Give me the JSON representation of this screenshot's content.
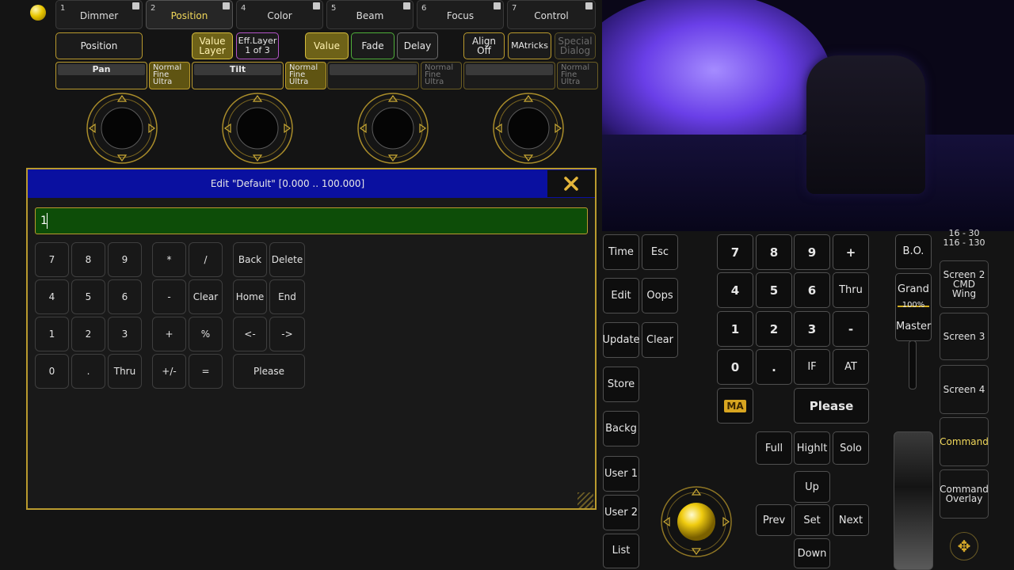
{
  "presetTabs": [
    {
      "num": "1",
      "label": "Dimmer"
    },
    {
      "num": "2",
      "label": "Position"
    },
    {
      "num": "4",
      "label": "Color"
    },
    {
      "num": "5",
      "label": "Beam"
    },
    {
      "num": "6",
      "label": "Focus"
    },
    {
      "num": "7",
      "label": "Control"
    }
  ],
  "toolbar": {
    "position": "Position",
    "valueLayer": [
      "Value",
      "Layer"
    ],
    "effLayer": [
      "Eff.Layer",
      "1 of 3"
    ],
    "value": "Value",
    "fade": "Fade",
    "delay": "Delay",
    "alignOff": [
      "Align",
      "Off"
    ],
    "matricks": "MAtricks",
    "specialDialog": [
      "Special",
      "Dialog"
    ]
  },
  "encoders": [
    {
      "label": "Pan",
      "res": [
        "Normal",
        "Fine",
        "Ultra"
      ]
    },
    {
      "label": "Tilt",
      "res": [
        "Normal",
        "Fine",
        "Ultra"
      ]
    },
    {
      "label": "",
      "res": [
        "Normal",
        "Fine",
        "Ultra"
      ]
    },
    {
      "label": "",
      "res": [
        "Normal",
        "Fine",
        "Ultra"
      ]
    }
  ],
  "editDialog": {
    "title": "Edit \"Default\" [0.000 .. 100.000]",
    "input": "1",
    "keys": {
      "n7": "7",
      "n8": "8",
      "n9": "9",
      "mul": "*",
      "div": "/",
      "back": "Back",
      "del": "Delete",
      "n4": "4",
      "n5": "5",
      "n6": "6",
      "minus": "-",
      "clear": "Clear",
      "home": "Home",
      "end": "End",
      "n1": "1",
      "n2": "2",
      "n3": "3",
      "plus": "+",
      "pct": "%",
      "left": "<-",
      "right": "->",
      "n0": "0",
      "dot": ".",
      "thru": "Thru",
      "pm": "+/-",
      "eq": "=",
      "please": "Please"
    }
  },
  "wing": {
    "left": [
      "Time",
      "Esc",
      "Edit",
      "Oops",
      "Update",
      "Clear",
      "Store",
      "Backg",
      "User 1",
      "User 2",
      "List"
    ],
    "numpad": [
      "7",
      "8",
      "9",
      "+",
      "4",
      "5",
      "6",
      "Thru",
      "1",
      "2",
      "3",
      "-",
      "0",
      ".",
      "IF",
      "AT"
    ],
    "ma": "MA",
    "please": "Please",
    "row": [
      "Full",
      "Highlt",
      "Solo"
    ],
    "nav": {
      "up": "Up",
      "prev": "Prev",
      "set": "Set",
      "next": "Next",
      "down": "Down"
    },
    "bo": "B.O.",
    "grand": "Grand",
    "master": "Master",
    "pct": "100%"
  },
  "screens": {
    "range": [
      "16 - 30",
      "116 - 130"
    ],
    "s2": [
      "Screen 2",
      "CMD Wing"
    ],
    "s3": "Screen 3",
    "s4": "Screen 4",
    "command": "Command",
    "overlay": [
      "Command",
      "Overlay"
    ]
  }
}
